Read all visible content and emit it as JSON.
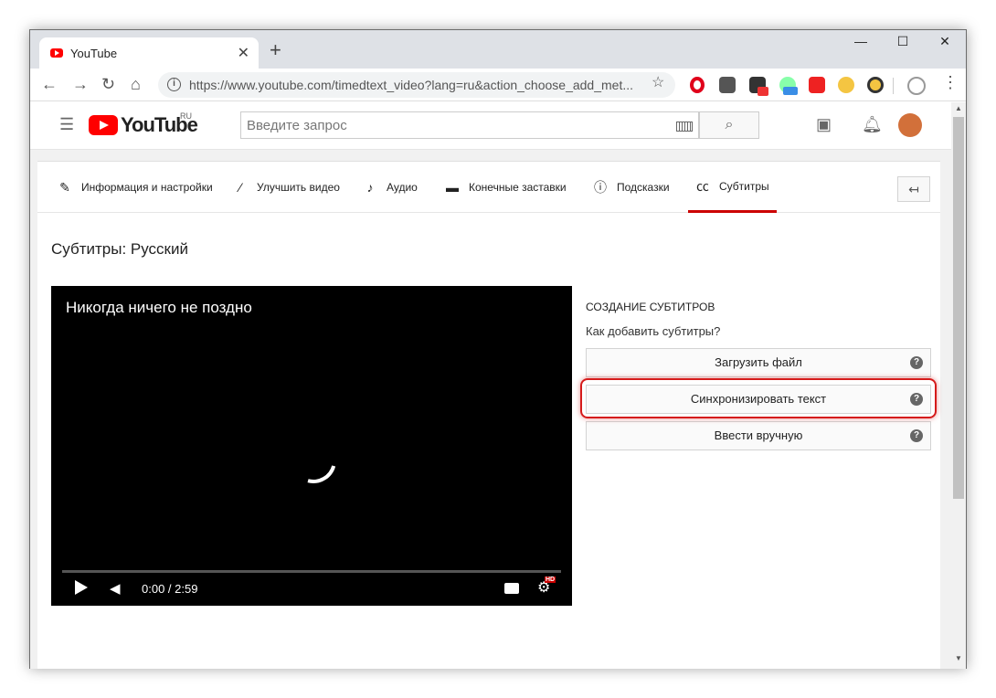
{
  "browser": {
    "tab_title": "YouTube",
    "url": "https://www.youtube.com/timedtext_video?lang=ru&action_choose_add_met..."
  },
  "youtube": {
    "logo_text": "YouTube",
    "logo_region": "RU",
    "search_placeholder": "Введите запрос"
  },
  "tabs": [
    {
      "label": "Информация и настройки",
      "icon": "pencil-icon"
    },
    {
      "label": "Улучшить видео",
      "icon": "magic-wand-icon"
    },
    {
      "label": "Аудио",
      "icon": "music-note-icon"
    },
    {
      "label": "Конечные заставки",
      "icon": "end-screen-icon"
    },
    {
      "label": "Подсказки",
      "icon": "info-icon"
    },
    {
      "label": "Субтитры",
      "icon": "cc-icon",
      "active": true
    }
  ],
  "page_title": "Субтитры: Русский",
  "video": {
    "title": "Никогда ничего не поздно",
    "time": "0:00 / 2:59",
    "hd_badge": "HD"
  },
  "subtitles_panel": {
    "heading": "Создание субтитров",
    "question": "Как добавить субтитры?",
    "options": [
      {
        "label": "Загрузить файл"
      },
      {
        "label": "Синхронизировать текст",
        "highlighted": true
      },
      {
        "label": "Ввести вручную"
      }
    ],
    "help_glyph": "?"
  }
}
